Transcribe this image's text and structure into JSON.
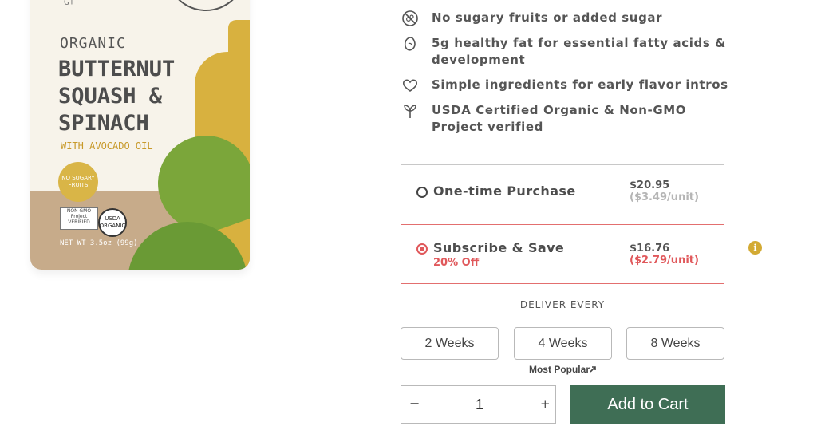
{
  "product_image": {
    "side_mark": "G+",
    "organic_label": "ORGANIC",
    "title": "BUTTERNUT SQUASH & SPINACH",
    "subtitle": "WITH AVOCADO OIL",
    "badge": "NO SUGARY FRUITS",
    "cert_label": "NON GMO Project VERIFIED",
    "usda_label": "USDA ORGANIC",
    "net_weight": "NET WT 3.5oz (99g)"
  },
  "benefits": [
    {
      "icon": "no-sugar-icon",
      "text": "No sugary fruits or added sugar"
    },
    {
      "icon": "avocado-icon",
      "text": "5g healthy fat for essential fatty acids & development"
    },
    {
      "icon": "heart-icon",
      "text": "Simple ingredients for early flavor intros"
    },
    {
      "icon": "sprout-icon",
      "text": "USDA Certified Organic & Non-GMO Project verified"
    }
  ],
  "purchase": {
    "one_time": {
      "label": "One-time Purchase",
      "price": "$20.95",
      "unit": "($3.49/unit)",
      "selected": false
    },
    "subscribe": {
      "label": "Subscribe & Save",
      "discount": "20% Off",
      "price": "$16.76",
      "unit": "($2.79/unit)",
      "selected": true
    },
    "info_icon": "info-icon"
  },
  "delivery": {
    "label": "DELIVER EVERY",
    "options": [
      "2 Weeks",
      "4 Weeks",
      "8 Weeks"
    ],
    "popular_label": "Most Popular",
    "popular_icon": "arrow-up-icon"
  },
  "quantity": {
    "minus": "−",
    "value": "1",
    "plus": "+"
  },
  "cart": {
    "label": "Add to Cart"
  },
  "colors": {
    "accent_red": "#e0585b",
    "cart_green": "#3f6e55",
    "info_gold": "#d3aa33"
  }
}
